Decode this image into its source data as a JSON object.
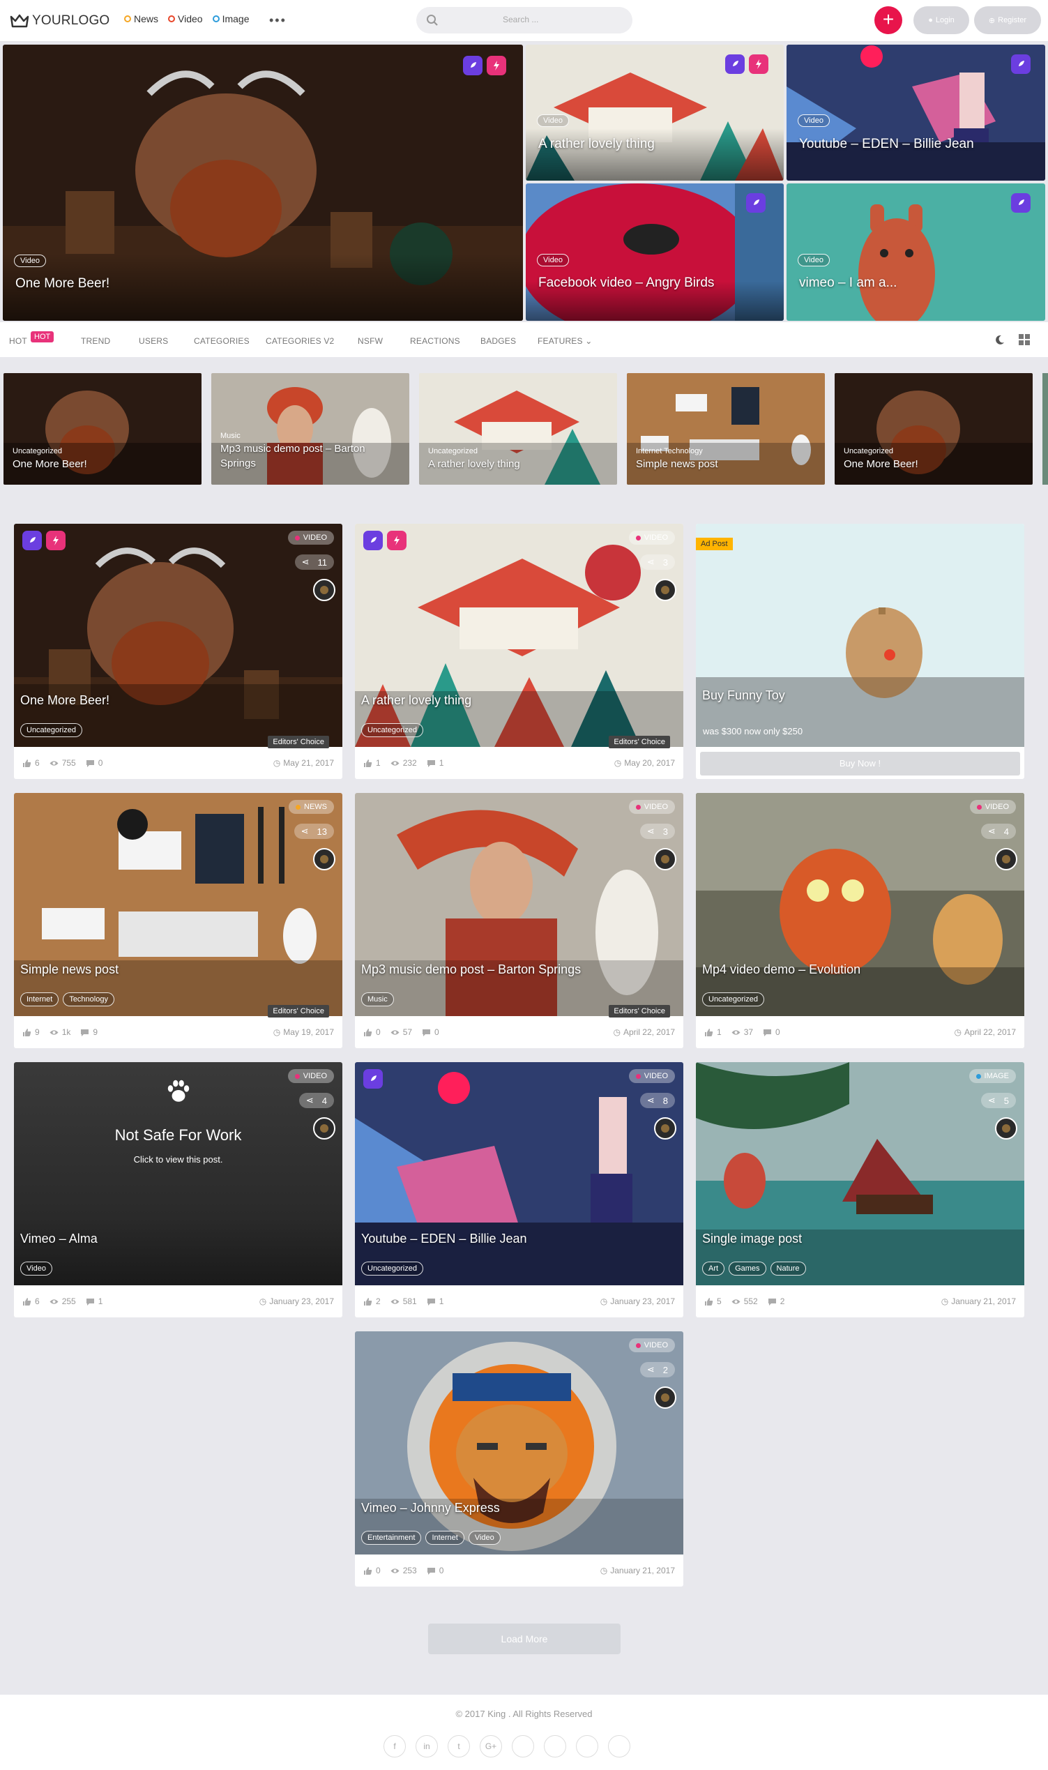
{
  "header": {
    "logo": "YOURLOGO",
    "nav": [
      {
        "label": "News",
        "color": "#f5a623"
      },
      {
        "label": "Video",
        "color": "#e8462a"
      },
      {
        "label": "Image",
        "color": "#2d9cdb"
      }
    ],
    "more": "•••",
    "search_placeholder": "Search ...",
    "login": "Login",
    "register": "Register",
    "create": "+"
  },
  "featured": [
    {
      "tag": "Video",
      "title": "One More Beer!"
    },
    {
      "tag": "Video",
      "title": "A rather lovely thing"
    },
    {
      "tag": "Video",
      "title": "Youtube – EDEN – Billie Jean"
    },
    {
      "tag": "Video",
      "title": "Facebook video – Angry Birds"
    },
    {
      "tag": "Video",
      "title": "vimeo – I am a..."
    }
  ],
  "tabs": [
    {
      "label": "HOT",
      "badge": "HOT"
    },
    {
      "label": "TREND"
    },
    {
      "label": "USERS"
    },
    {
      "label": "CATEGORIES"
    },
    {
      "label": "CATEGORIES V2"
    },
    {
      "label": "NSFW"
    },
    {
      "label": "REACTIONS"
    },
    {
      "label": "BADGES"
    },
    {
      "label": "FEATURES"
    }
  ],
  "slider": [
    {
      "cat": "Uncategorized",
      "title": "One More Beer!"
    },
    {
      "cat": "Music",
      "title": "Mp3 music demo post – Barton Springs"
    },
    {
      "cat": "Uncategorized",
      "title": "A rather lovely thing"
    },
    {
      "cat": "Internet Technology",
      "title": "Simple news post"
    },
    {
      "cat": "Uncategorized",
      "title": "One More Beer!"
    }
  ],
  "cards": [
    {
      "title": "One More Beer!",
      "type": "VIDEO",
      "type_color": "#e8327a",
      "shares": "11",
      "tags": [
        "Uncategorized"
      ],
      "editors": "Editors' Choice",
      "likes": "6",
      "views": "755",
      "comments": "0",
      "date": "May 21, 2017"
    },
    {
      "title": "A rather lovely thing",
      "type": "VIDEO",
      "type_color": "#e8327a",
      "shares": "3",
      "tags": [
        "Uncategorized"
      ],
      "editors": "Editors' Choice",
      "likes": "1",
      "views": "232",
      "comments": "1",
      "date": "May 20, 2017"
    },
    {
      "title": "Buy Funny Toy",
      "ad": "Ad Post",
      "price": "was $300 now only $250",
      "buy": "Buy Now !"
    },
    {
      "title": "Simple news post",
      "type": "NEWS",
      "type_color": "#f5a623",
      "shares": "13",
      "tags": [
        "Internet",
        "Technology"
      ],
      "editors": "Editors' Choice",
      "likes": "9",
      "views": "1k",
      "comments": "9",
      "date": "May 19, 2017"
    },
    {
      "title": "Mp3 music demo post – Barton Springs",
      "type": "VIDEO",
      "type_color": "#e8327a",
      "shares": "3",
      "tags": [
        "Music"
      ],
      "editors": "Editors' Choice",
      "likes": "0",
      "views": "57",
      "comments": "0",
      "date": "April 22, 2017"
    },
    {
      "title": "Mp4 video demo – Evolution",
      "type": "VIDEO",
      "type_color": "#e8327a",
      "shares": "4",
      "tags": [
        "Uncategorized"
      ],
      "likes": "1",
      "views": "37",
      "comments": "0",
      "date": "April 22, 2017"
    },
    {
      "title": "Vimeo – Alma",
      "type": "VIDEO",
      "type_color": "#e8327a",
      "shares": "4",
      "tags": [
        "Video"
      ],
      "nsfw_title": "Not Safe For Work",
      "nsfw_sub": "Click to view this post.",
      "likes": "6",
      "views": "255",
      "comments": "1",
      "date": "January 23, 2017"
    },
    {
      "title": "Youtube – EDEN – Billie Jean",
      "type": "VIDEO",
      "type_color": "#e8327a",
      "shares": "8",
      "tags": [
        "Uncategorized"
      ],
      "likes": "2",
      "views": "581",
      "comments": "1",
      "date": "January 23, 2017"
    },
    {
      "title": "Single image post",
      "type": "IMAGE",
      "type_color": "#2d9cdb",
      "shares": "5",
      "tags": [
        "Art",
        "Games",
        "Nature"
      ],
      "likes": "5",
      "views": "552",
      "comments": "2",
      "date": "January 21, 2017"
    },
    {
      "title": "Vimeo – Johnny Express",
      "type": "VIDEO",
      "type_color": "#e8327a",
      "shares": "2",
      "tags": [
        "Entertainment",
        "Internet",
        "Video"
      ],
      "likes": "0",
      "views": "253",
      "comments": "0",
      "date": "January 21, 2017"
    }
  ],
  "load_more": "Load More",
  "footer": {
    "copyright": "© 2017 King . All Rights Reserved",
    "social": [
      "f",
      "in",
      "t",
      "G+",
      "",
      "",
      "",
      ""
    ]
  }
}
